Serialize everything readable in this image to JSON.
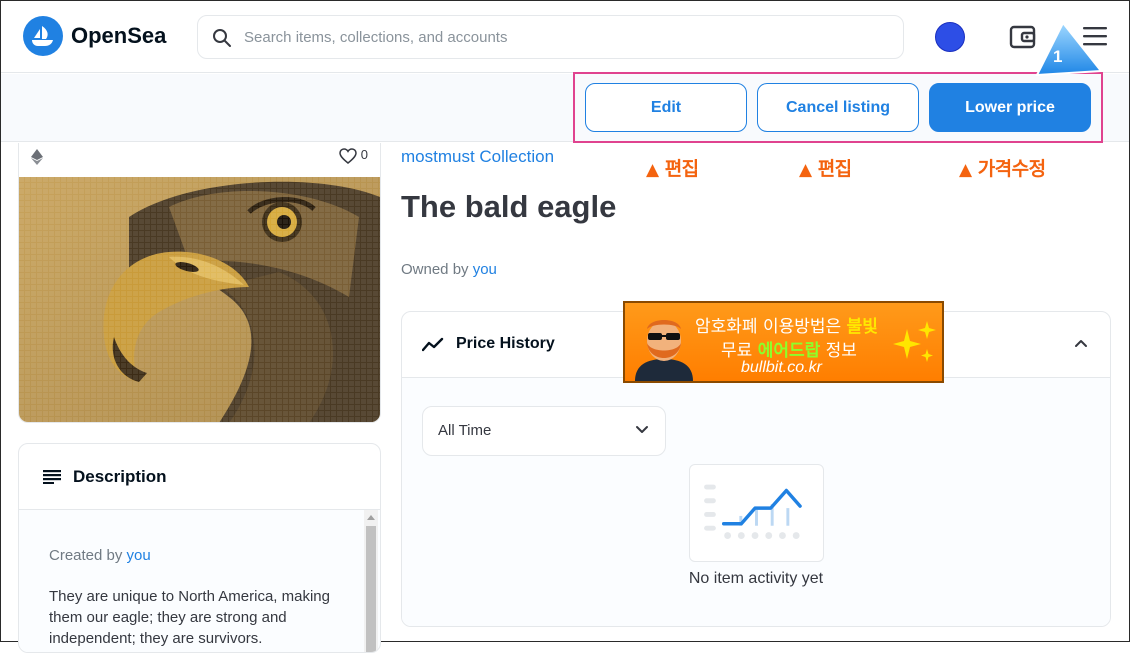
{
  "header": {
    "brand": "OpenSea",
    "search_placeholder": "Search items, collections, and accounts"
  },
  "annotation": {
    "step_number": "1"
  },
  "actions": {
    "edit": "Edit",
    "cancel": "Cancel listing",
    "lower": "Lower price"
  },
  "hints": [
    {
      "arrow": "▲",
      "text": "편집"
    },
    {
      "arrow": "▲",
      "text": "편집"
    },
    {
      "arrow": "▲",
      "text": "가격수정"
    }
  ],
  "item": {
    "favorites": "0",
    "collection": "mostmust Collection",
    "title": "The bald eagle",
    "owned_prefix": "Owned by ",
    "owner": "you"
  },
  "description": {
    "title": "Description",
    "created_prefix": "Created by ",
    "creator": "you",
    "text": "They are unique to North America, making them our eagle; they are strong and independent; they are survivors."
  },
  "price_history": {
    "title": "Price History",
    "range": "All Time",
    "empty": "No item activity yet"
  },
  "banner": {
    "line1_a": "암호화폐 이용방법은 ",
    "line1_b": "불빛",
    "line2_a": "무료 ",
    "line2_b": "에어드랍",
    "line2_c": " 정보",
    "url": "bullbit.co.kr"
  },
  "colors": {
    "accent": "#2081e2",
    "highlight": "#e0438f",
    "hint": "#f4630f"
  }
}
